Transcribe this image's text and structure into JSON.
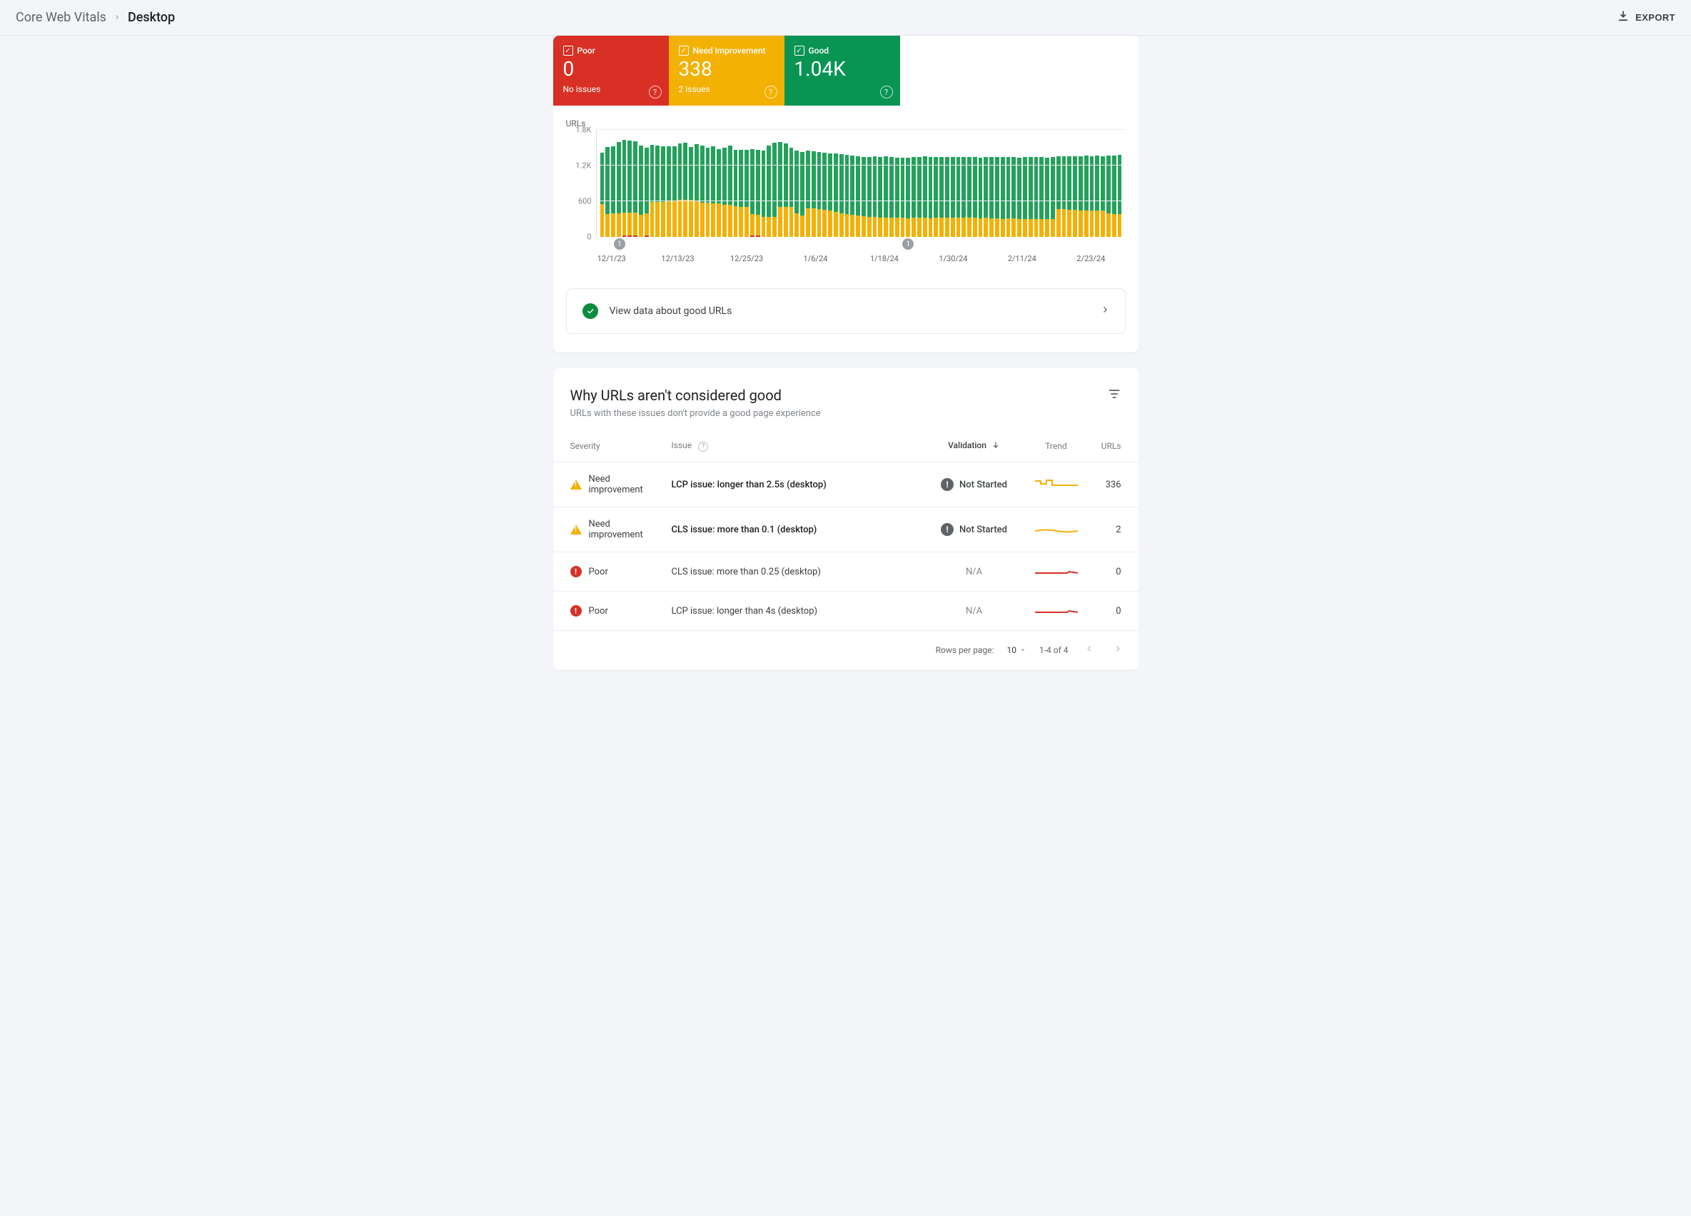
{
  "breadcrumb": {
    "parent": "Core Web Vitals",
    "current": "Desktop"
  },
  "export_label": "EXPORT",
  "tiles": {
    "poor": {
      "label": "Poor",
      "value": "0",
      "sub": "No issues"
    },
    "need": {
      "label": "Need improvement",
      "value": "338",
      "sub": "2 issues"
    },
    "good": {
      "label": "Good",
      "value": "1.04K",
      "sub": ""
    }
  },
  "chart_data": {
    "type": "bar",
    "title": "URLs",
    "ymax": 1800,
    "yticks": [
      0,
      600,
      1200,
      1800
    ],
    "ytick_labels": [
      "0",
      "600",
      "1.2K",
      "1.8K"
    ],
    "xlabels": [
      {
        "pos": 0.03,
        "text": "12/1/23"
      },
      {
        "pos": 0.155,
        "text": "12/13/23"
      },
      {
        "pos": 0.285,
        "text": "12/25/23"
      },
      {
        "pos": 0.415,
        "text": "1/6/24"
      },
      {
        "pos": 0.545,
        "text": "1/18/24"
      },
      {
        "pos": 0.675,
        "text": "1/30/24"
      },
      {
        "pos": 0.805,
        "text": "2/11/24"
      },
      {
        "pos": 0.935,
        "text": "2/23/24"
      }
    ],
    "annotations": [
      {
        "pos": 0.045,
        "label": "1"
      },
      {
        "pos": 0.59,
        "label": "1"
      }
    ],
    "series_legend": [
      "Poor",
      "Need improvement",
      "Good"
    ],
    "bars": [
      {
        "p": 0,
        "n": 550,
        "g": 870
      },
      {
        "p": 0,
        "n": 380,
        "g": 1130
      },
      {
        "p": 0,
        "n": 400,
        "g": 1130
      },
      {
        "p": 0,
        "n": 400,
        "g": 1200
      },
      {
        "p": 20,
        "n": 390,
        "g": 1220
      },
      {
        "p": 20,
        "n": 390,
        "g": 1210
      },
      {
        "p": 25,
        "n": 380,
        "g": 1200
      },
      {
        "p": 0,
        "n": 370,
        "g": 1170
      },
      {
        "p": 30,
        "n": 370,
        "g": 1100
      },
      {
        "p": 0,
        "n": 590,
        "g": 960
      },
      {
        "p": 0,
        "n": 590,
        "g": 950
      },
      {
        "p": 0,
        "n": 590,
        "g": 940
      },
      {
        "p": 0,
        "n": 600,
        "g": 920
      },
      {
        "p": 0,
        "n": 610,
        "g": 920
      },
      {
        "p": 0,
        "n": 620,
        "g": 950
      },
      {
        "p": 0,
        "n": 620,
        "g": 960
      },
      {
        "p": 0,
        "n": 630,
        "g": 880
      },
      {
        "p": 0,
        "n": 600,
        "g": 960
      },
      {
        "p": 0,
        "n": 580,
        "g": 960
      },
      {
        "p": 0,
        "n": 580,
        "g": 920
      },
      {
        "p": 0,
        "n": 560,
        "g": 960
      },
      {
        "p": 0,
        "n": 560,
        "g": 920
      },
      {
        "p": 0,
        "n": 540,
        "g": 960
      },
      {
        "p": 0,
        "n": 540,
        "g": 1000
      },
      {
        "p": 0,
        "n": 520,
        "g": 940
      },
      {
        "p": 0,
        "n": 510,
        "g": 950
      },
      {
        "p": 0,
        "n": 500,
        "g": 960
      },
      {
        "p": 20,
        "n": 370,
        "g": 1090
      },
      {
        "p": 20,
        "n": 350,
        "g": 1090
      },
      {
        "p": 0,
        "n": 340,
        "g": 1110
      },
      {
        "p": 0,
        "n": 340,
        "g": 1200
      },
      {
        "p": 0,
        "n": 340,
        "g": 1240
      },
      {
        "p": 0,
        "n": 500,
        "g": 1100
      },
      {
        "p": 0,
        "n": 510,
        "g": 1060
      },
      {
        "p": 0,
        "n": 500,
        "g": 1000
      },
      {
        "p": 0,
        "n": 400,
        "g": 1050
      },
      {
        "p": 0,
        "n": 360,
        "g": 1070
      },
      {
        "p": 0,
        "n": 480,
        "g": 970
      },
      {
        "p": 0,
        "n": 480,
        "g": 960
      },
      {
        "p": 0,
        "n": 470,
        "g": 960
      },
      {
        "p": 0,
        "n": 460,
        "g": 960
      },
      {
        "p": 0,
        "n": 440,
        "g": 970
      },
      {
        "p": 0,
        "n": 420,
        "g": 980
      },
      {
        "p": 0,
        "n": 400,
        "g": 990
      },
      {
        "p": 0,
        "n": 380,
        "g": 1000
      },
      {
        "p": 0,
        "n": 370,
        "g": 1000
      },
      {
        "p": 0,
        "n": 360,
        "g": 1000
      },
      {
        "p": 0,
        "n": 350,
        "g": 1000
      },
      {
        "p": 0,
        "n": 340,
        "g": 1010
      },
      {
        "p": 0,
        "n": 340,
        "g": 1020
      },
      {
        "p": 0,
        "n": 330,
        "g": 1020
      },
      {
        "p": 0,
        "n": 330,
        "g": 1030
      },
      {
        "p": 0,
        "n": 320,
        "g": 1020
      },
      {
        "p": 0,
        "n": 320,
        "g": 1010
      },
      {
        "p": 0,
        "n": 320,
        "g": 1010
      },
      {
        "p": 0,
        "n": 310,
        "g": 1020
      },
      {
        "p": 0,
        "n": 320,
        "g": 1020
      },
      {
        "p": 0,
        "n": 320,
        "g": 1020
      },
      {
        "p": 0,
        "n": 320,
        "g": 1040
      },
      {
        "p": 0,
        "n": 310,
        "g": 1040
      },
      {
        "p": 0,
        "n": 320,
        "g": 1030
      },
      {
        "p": 0,
        "n": 320,
        "g": 1020
      },
      {
        "p": 0,
        "n": 320,
        "g": 1020
      },
      {
        "p": 0,
        "n": 320,
        "g": 1020
      },
      {
        "p": 0,
        "n": 320,
        "g": 1020
      },
      {
        "p": 0,
        "n": 320,
        "g": 1020
      },
      {
        "p": 0,
        "n": 320,
        "g": 1020
      },
      {
        "p": 0,
        "n": 320,
        "g": 1020
      },
      {
        "p": 0,
        "n": 310,
        "g": 1020
      },
      {
        "p": 0,
        "n": 320,
        "g": 1020
      },
      {
        "p": 0,
        "n": 310,
        "g": 1030
      },
      {
        "p": 0,
        "n": 310,
        "g": 1030
      },
      {
        "p": 0,
        "n": 300,
        "g": 1040
      },
      {
        "p": 0,
        "n": 310,
        "g": 1030
      },
      {
        "p": 0,
        "n": 310,
        "g": 1030
      },
      {
        "p": 0,
        "n": 300,
        "g": 1030
      },
      {
        "p": 0,
        "n": 300,
        "g": 1040
      },
      {
        "p": 0,
        "n": 300,
        "g": 1040
      },
      {
        "p": 0,
        "n": 300,
        "g": 1040
      },
      {
        "p": 0,
        "n": 300,
        "g": 1040
      },
      {
        "p": 0,
        "n": 300,
        "g": 1030
      },
      {
        "p": 0,
        "n": 300,
        "g": 1040
      },
      {
        "p": 0,
        "n": 470,
        "g": 890
      },
      {
        "p": 0,
        "n": 470,
        "g": 890
      },
      {
        "p": 0,
        "n": 460,
        "g": 900
      },
      {
        "p": 0,
        "n": 460,
        "g": 900
      },
      {
        "p": 0,
        "n": 450,
        "g": 910
      },
      {
        "p": 0,
        "n": 450,
        "g": 920
      },
      {
        "p": 0,
        "n": 440,
        "g": 920
      },
      {
        "p": 0,
        "n": 450,
        "g": 920
      },
      {
        "p": 0,
        "n": 450,
        "g": 910
      },
      {
        "p": 0,
        "n": 400,
        "g": 970
      },
      {
        "p": 0,
        "n": 390,
        "g": 980
      },
      {
        "p": 0,
        "n": 390,
        "g": 990
      }
    ]
  },
  "good_banner": {
    "text": "View data about good URLs"
  },
  "issues_card": {
    "title": "Why URLs aren't considered good",
    "subtitle": "URLs with these issues don't provide a good page experience",
    "columns": {
      "severity": "Severity",
      "issue": "Issue",
      "validation": "Validation",
      "trend": "Trend",
      "urls": "URLs"
    },
    "rows": [
      {
        "severity_kind": "need",
        "severity": "Need improvement",
        "issue": "LCP issue: longer than 2.5s (desktop)",
        "issue_bold": true,
        "validation": "Not Started",
        "validation_icon": true,
        "trend": "warn-step",
        "urls": "336"
      },
      {
        "severity_kind": "need",
        "severity": "Need improvement",
        "issue": "CLS issue: more than 0.1 (desktop)",
        "issue_bold": true,
        "validation": "Not Started",
        "validation_icon": true,
        "trend": "warn-flat",
        "urls": "2"
      },
      {
        "severity_kind": "poor",
        "severity": "Poor",
        "issue": "CLS issue: more than 0.25 (desktop)",
        "issue_bold": false,
        "validation": "N/A",
        "validation_icon": false,
        "trend": "red-line",
        "urls": "0"
      },
      {
        "severity_kind": "poor",
        "severity": "Poor",
        "issue": "LCP issue: longer than 4s (desktop)",
        "issue_bold": false,
        "validation": "N/A",
        "validation_icon": false,
        "trend": "red-line",
        "urls": "0"
      }
    ],
    "pager": {
      "rows_per_page_label": "Rows per page:",
      "rows_per_page": "10",
      "range": "1-4 of 4"
    }
  }
}
